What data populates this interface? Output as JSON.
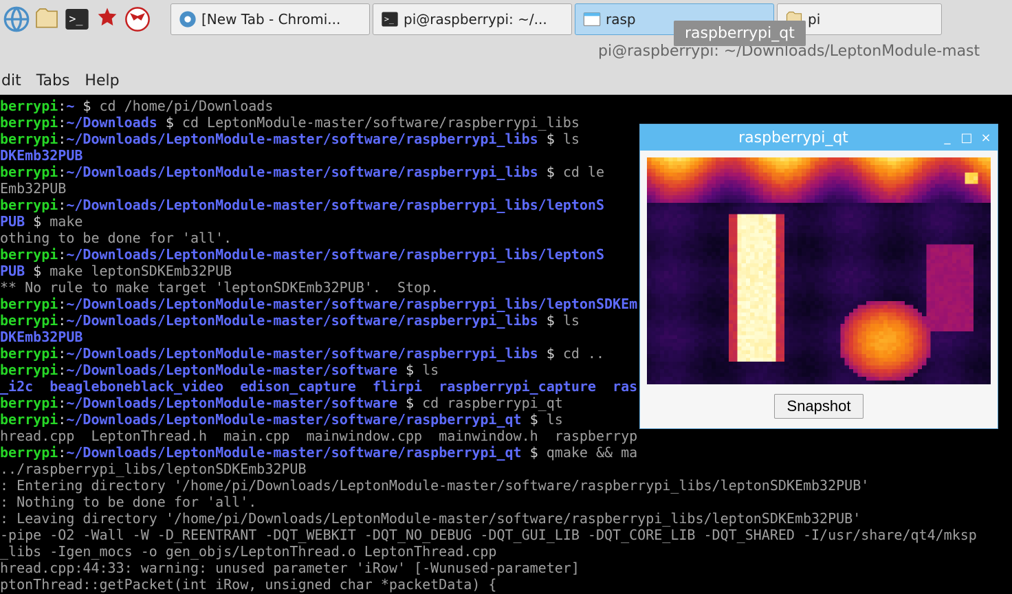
{
  "taskbar": {
    "buttons": [
      {
        "label": "[New Tab - Chromi...",
        "icon": "chromium"
      },
      {
        "label": "pi@raspberrypi: ~/...",
        "icon": "terminal"
      },
      {
        "label": "rasp",
        "icon": "window",
        "active": true
      },
      {
        "label": "pi",
        "icon": "folder"
      }
    ]
  },
  "tooltip": "raspberrypi_qt",
  "subtitle": "pi@raspberrypi: ~/Downloads/LeptonModule-mast",
  "menu": {
    "items": [
      "dit",
      "Tabs",
      "Help"
    ]
  },
  "qt": {
    "title": "raspberrypi_qt",
    "snapshot": "Snapshot"
  },
  "term": {
    "lines": [
      {
        "seg": [
          {
            "c": "g",
            "t": "berrypi"
          },
          {
            "c": "w",
            "t": ":"
          },
          {
            "c": "b",
            "t": "~"
          },
          {
            "c": "w",
            "t": " $ "
          },
          {
            "c": "gr",
            "t": "cd /home/pi/Downloads"
          }
        ]
      },
      {
        "seg": [
          {
            "c": "g",
            "t": "berrypi"
          },
          {
            "c": "w",
            "t": ":"
          },
          {
            "c": "b",
            "t": "~/Downloads"
          },
          {
            "c": "w",
            "t": " $ "
          },
          {
            "c": "gr",
            "t": "cd LeptonModule-master/software/raspberrypi_libs"
          }
        ]
      },
      {
        "seg": [
          {
            "c": "g",
            "t": "berrypi"
          },
          {
            "c": "w",
            "t": ":"
          },
          {
            "c": "b",
            "t": "~/Downloads/LeptonModule-master/software/raspberrypi_libs"
          },
          {
            "c": "w",
            "t": " $ "
          },
          {
            "c": "gr",
            "t": "ls"
          }
        ]
      },
      {
        "seg": [
          {
            "c": "b",
            "t": "DKEmb32PUB"
          }
        ]
      },
      {
        "seg": [
          {
            "c": "g",
            "t": "berrypi"
          },
          {
            "c": "w",
            "t": ":"
          },
          {
            "c": "b",
            "t": "~/Downloads/LeptonModule-master/software/raspberrypi_libs"
          },
          {
            "c": "w",
            "t": " $ "
          },
          {
            "c": "gr",
            "t": "cd le"
          }
        ]
      },
      {
        "seg": [
          {
            "c": "gr",
            "t": "Emb32PUB"
          }
        ]
      },
      {
        "seg": [
          {
            "c": "g",
            "t": "berrypi"
          },
          {
            "c": "w",
            "t": ":"
          },
          {
            "c": "b",
            "t": "~/Downloads/LeptonModule-master/software/raspberrypi_libs/leptonS"
          }
        ]
      },
      {
        "seg": [
          {
            "c": "b",
            "t": "PUB"
          },
          {
            "c": "w",
            "t": " $ "
          },
          {
            "c": "gr",
            "t": "make"
          }
        ]
      },
      {
        "seg": [
          {
            "c": "gr",
            "t": "othing to be done for 'all'."
          }
        ]
      },
      {
        "seg": [
          {
            "c": "g",
            "t": "berrypi"
          },
          {
            "c": "w",
            "t": ":"
          },
          {
            "c": "b",
            "t": "~/Downloads/LeptonModule-master/software/raspberrypi_libs/leptonS"
          }
        ]
      },
      {
        "seg": [
          {
            "c": "b",
            "t": "PUB"
          },
          {
            "c": "w",
            "t": " $ "
          },
          {
            "c": "gr",
            "t": "make leptonSDKEmb32PUB"
          }
        ]
      },
      {
        "seg": [
          {
            "c": "gr",
            "t": "** No rule to make target 'leptonSDKEmb32PUB'.  Stop."
          }
        ]
      },
      {
        "seg": [
          {
            "c": "g",
            "t": "berrypi"
          },
          {
            "c": "w",
            "t": ":"
          },
          {
            "c": "b",
            "t": "~/Downloads/LeptonModule-master/software/raspberrypi_libs/leptonSDKEm"
          }
        ]
      },
      {
        "seg": [
          {
            "c": "g",
            "t": "berrypi"
          },
          {
            "c": "w",
            "t": ":"
          },
          {
            "c": "b",
            "t": "~/Downloads/LeptonModule-master/software/raspberrypi_libs"
          },
          {
            "c": "w",
            "t": " $ "
          },
          {
            "c": "gr",
            "t": "ls"
          }
        ]
      },
      {
        "seg": [
          {
            "c": "b",
            "t": "DKEmb32PUB"
          }
        ]
      },
      {
        "seg": [
          {
            "c": "g",
            "t": "berrypi"
          },
          {
            "c": "w",
            "t": ":"
          },
          {
            "c": "b",
            "t": "~/Downloads/LeptonModule-master/software/raspberrypi_libs"
          },
          {
            "c": "w",
            "t": " $ "
          },
          {
            "c": "gr",
            "t": "cd .."
          }
        ]
      },
      {
        "seg": [
          {
            "c": "g",
            "t": "berrypi"
          },
          {
            "c": "w",
            "t": ":"
          },
          {
            "c": "b",
            "t": "~/Downloads/LeptonModule-master/software"
          },
          {
            "c": "w",
            "t": " $ "
          },
          {
            "c": "gr",
            "t": "ls"
          }
        ]
      },
      {
        "seg": [
          {
            "c": "b",
            "t": "_i2c  beagleboneblack_video  edison_capture  flirpi  raspberrypi_capture  ras"
          }
        ]
      },
      {
        "seg": [
          {
            "c": "g",
            "t": "berrypi"
          },
          {
            "c": "w",
            "t": ":"
          },
          {
            "c": "b",
            "t": "~/Downloads/LeptonModule-master/software"
          },
          {
            "c": "w",
            "t": " $ "
          },
          {
            "c": "gr",
            "t": "cd raspberrypi_qt"
          }
        ]
      },
      {
        "seg": [
          {
            "c": "g",
            "t": "berrypi"
          },
          {
            "c": "w",
            "t": ":"
          },
          {
            "c": "b",
            "t": "~/Downloads/LeptonModule-master/software/raspberrypi_qt"
          },
          {
            "c": "w",
            "t": " $ "
          },
          {
            "c": "gr",
            "t": "ls"
          }
        ]
      },
      {
        "seg": [
          {
            "c": "gr",
            "t": "hread.cpp  LeptonThread.h  main.cpp  mainwindow.cpp  mainwindow.h  raspberryp"
          }
        ]
      },
      {
        "seg": [
          {
            "c": "g",
            "t": "berrypi"
          },
          {
            "c": "w",
            "t": ":"
          },
          {
            "c": "b",
            "t": "~/Downloads/LeptonModule-master/software/raspberrypi_qt"
          },
          {
            "c": "w",
            "t": " $ "
          },
          {
            "c": "gr",
            "t": "qmake && ma"
          }
        ]
      },
      {
        "seg": [
          {
            "c": "gr",
            "t": "../raspberrypi_libs/leptonSDKEmb32PUB"
          }
        ]
      },
      {
        "seg": [
          {
            "c": "gr",
            "t": ": Entering directory '/home/pi/Downloads/LeptonModule-master/software/raspberrypi_libs/leptonSDKEmb32PUB'"
          }
        ]
      },
      {
        "seg": [
          {
            "c": "gr",
            "t": ": Nothing to be done for 'all'."
          }
        ]
      },
      {
        "seg": [
          {
            "c": "gr",
            "t": ": Leaving directory '/home/pi/Downloads/LeptonModule-master/software/raspberrypi_libs/leptonSDKEmb32PUB'"
          }
        ]
      },
      {
        "seg": [
          {
            "c": "gr",
            "t": "-pipe -O2 -Wall -W -D_REENTRANT -DQT_WEBKIT -DQT_NO_DEBUG -DQT_GUI_LIB -DQT_CORE_LIB -DQT_SHARED -I/usr/share/qt4/mksp"
          }
        ]
      },
      {
        "seg": [
          {
            "c": "gr",
            "t": "_libs -Igen_mocs -o gen_objs/LeptonThread.o LeptonThread.cpp"
          }
        ]
      },
      {
        "seg": [
          {
            "c": "gr",
            "t": "hread.cpp:44:33: warning: unused parameter 'iRow' [-Wunused-parameter]"
          }
        ]
      },
      {
        "seg": [
          {
            "c": "gr",
            "t": "ptonThread::getPacket(int iRow, unsigned char *packetData) {"
          }
        ]
      }
    ]
  }
}
